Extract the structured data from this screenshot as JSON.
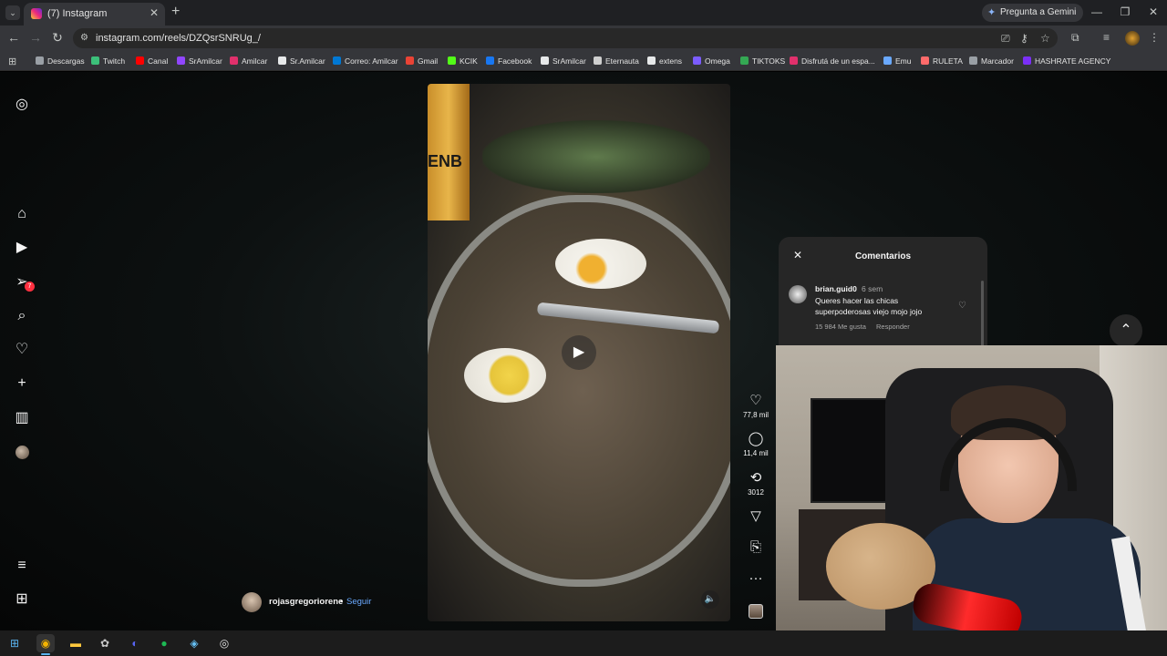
{
  "browser": {
    "tab": {
      "title": "(7) Instagram",
      "close": "✕"
    },
    "new_tab": "+",
    "gemini_label": "Pregunta a Gemini",
    "window_controls": {
      "minimize": "—",
      "maximize": "❐",
      "close": "✕"
    },
    "url": "instagram.com/reels/DZQsrSNRUg_/",
    "bookmarks": [
      {
        "label": "Descargas",
        "color": "#9aa0a6"
      },
      {
        "label": "Twitch",
        "color": "#3cc07a"
      },
      {
        "label": "Canal",
        "color": "#ff0000"
      },
      {
        "label": "SrAmilcar",
        "color": "#9146ff"
      },
      {
        "label": "Amilcar",
        "color": "#e1306c"
      },
      {
        "label": "Sr.Amilcar",
        "color": "#e7e9ea"
      },
      {
        "label": "Correo: Amilcar",
        "color": "#0078d4"
      },
      {
        "label": "Gmail",
        "color": "#ea4335"
      },
      {
        "label": "KCIK",
        "color": "#53fc18"
      },
      {
        "label": "Facebook",
        "color": "#1877f2"
      },
      {
        "label": "SrAmilcar",
        "color": "#e7e9ea"
      },
      {
        "label": "Eternauta",
        "color": "#cfcfcf"
      },
      {
        "label": "extens",
        "color": "#e7e9ea"
      },
      {
        "label": "Omega",
        "color": "#7b5cff"
      },
      {
        "label": "TIKTOKS",
        "color": "#34a853"
      },
      {
        "label": "Disfrutá de un espa...",
        "color": "#e1306c"
      },
      {
        "label": "Emu",
        "color": "#6aa9ff"
      },
      {
        "label": "RULETA",
        "color": "#ff6b6b"
      },
      {
        "label": "Marcador",
        "color": "#9aa0a6"
      },
      {
        "label": "HASHRATE AGENCY",
        "color": "#7b2ff7"
      }
    ]
  },
  "instagram": {
    "notification_count": "7",
    "sidebar_icons": [
      "instagram-logo-icon",
      "home-icon",
      "reels-icon",
      "messages-icon",
      "search-icon",
      "heart-icon",
      "create-icon",
      "dashboard-icon",
      "profile-avatar",
      "menu-icon",
      "more-apps-icon"
    ],
    "author": {
      "username": "rojasgregoriorene",
      "separator": "•",
      "follow_label": "Seguir"
    },
    "actions": {
      "likes": "77,8 mil",
      "comments": "11,4 mil",
      "reposts": "3012"
    },
    "video_can_text": "ENB",
    "comments_panel": {
      "title": "Comentarios",
      "comment": {
        "user": "brian.guid0",
        "time": "6 sem",
        "text": "Queres hacer las chicas superpoderosas viejo mojo jojo",
        "likes": "15 984 Me gusta",
        "reply_label": "Responder"
      }
    }
  },
  "taskbar_icons": [
    "windows-start-icon",
    "chrome-icon",
    "file-explorer-icon",
    "app-icon",
    "discord-icon",
    "spotify-icon",
    "steam-icon",
    "obs-icon"
  ]
}
